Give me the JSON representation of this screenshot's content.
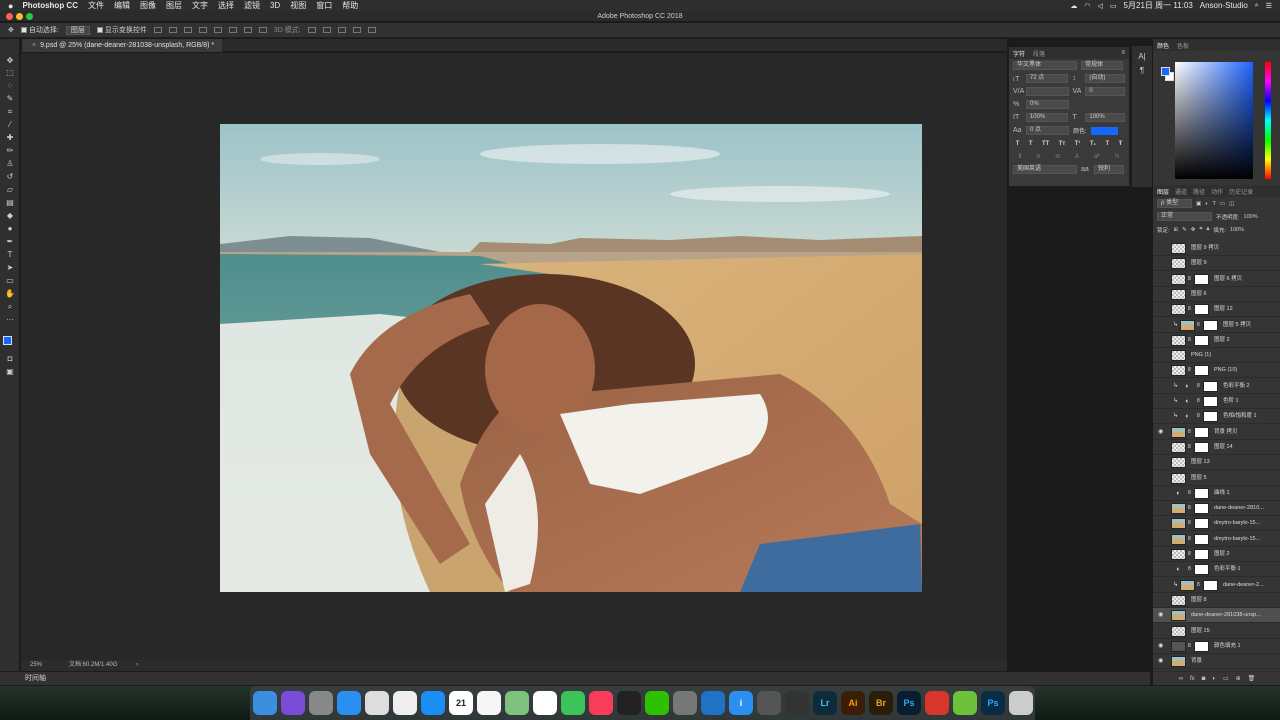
{
  "menubar": {
    "app_name": "Photoshop CC",
    "items": [
      "文件",
      "编辑",
      "图像",
      "图层",
      "文字",
      "选择",
      "滤镜",
      "3D",
      "视图",
      "窗口",
      "帮助"
    ],
    "datetime": "5月21日 周一 11:03",
    "user": "Anson-Studio"
  },
  "window": {
    "title": "Adobe Photoshop CC 2018",
    "tab": "9.psd @ 25% (dane-deaner-281038-unsplash, RGB/8) *"
  },
  "options": {
    "auto_select": "自动选择:",
    "auto_select_value": "图层",
    "show_transform": "显示变换控件",
    "mode_3d": "3D 模式:"
  },
  "status": {
    "zoom": "25%",
    "doc": "文档:60.2M/1.40G",
    "timeline": "时间轴"
  },
  "character": {
    "tabs": [
      "字符",
      "段落"
    ],
    "font_family": "华文黑体",
    "font_style": "常规体",
    "size": "72 点",
    "leading": "(自动)",
    "kerning": "",
    "tracking": "0",
    "scale_pct": "0%",
    "vscale": "100%",
    "hscale": "100%",
    "baseline": "0 点",
    "color_label": "颜色:",
    "language": "美国英语",
    "antialias": "锐利",
    "color": "#1467ff"
  },
  "colorpanel": {
    "tabs": [
      "颜色",
      "色板"
    ],
    "fg": "#1467ff",
    "bg": "#ffffff"
  },
  "layers": {
    "tabs": [
      "图层",
      "通道",
      "路径",
      "动作",
      "历史记录"
    ],
    "filter": "ρ 类型",
    "blend": "正常",
    "opacity_label": "不透明度:",
    "opacity": "100%",
    "lock_label": "锁定:",
    "fill_label": "填充:",
    "fill": "100%",
    "rows": [
      {
        "name": "图层 9 拷贝",
        "vis": false,
        "mask": false,
        "clip": false,
        "thumb": "check",
        "active": false
      },
      {
        "name": "图层 9",
        "vis": false,
        "mask": false,
        "clip": false,
        "thumb": "check",
        "active": false
      },
      {
        "name": "图层 6 拷贝",
        "vis": false,
        "mask": true,
        "clip": false,
        "thumb": "check",
        "active": false
      },
      {
        "name": "图层 6",
        "vis": false,
        "mask": false,
        "clip": false,
        "thumb": "check",
        "active": false
      },
      {
        "name": "图层 12",
        "vis": false,
        "mask": true,
        "clip": false,
        "thumb": "check",
        "active": false
      },
      {
        "name": "图层 5 拷贝",
        "vis": false,
        "mask": true,
        "clip": true,
        "thumb": "photo",
        "active": false
      },
      {
        "name": "图层 2",
        "vis": false,
        "mask": true,
        "clip": false,
        "thumb": "check",
        "active": false
      },
      {
        "name": "PNG (1)",
        "vis": false,
        "mask": false,
        "clip": false,
        "thumb": "check",
        "active": false
      },
      {
        "name": "PNG (10)",
        "vis": false,
        "mask": true,
        "clip": false,
        "thumb": "check",
        "active": false
      },
      {
        "name": "色彩平衡 2",
        "vis": false,
        "mask": true,
        "clip": true,
        "thumb": "adj",
        "active": false
      },
      {
        "name": "色阶 1",
        "vis": false,
        "mask": true,
        "clip": true,
        "thumb": "adj",
        "active": false
      },
      {
        "name": "色相/饱和度 1",
        "vis": false,
        "mask": true,
        "clip": true,
        "thumb": "adj",
        "active": false
      },
      {
        "name": "背景 拷贝",
        "vis": true,
        "mask": true,
        "clip": false,
        "thumb": "photo",
        "active": false
      },
      {
        "name": "图层 14",
        "vis": false,
        "mask": true,
        "clip": false,
        "thumb": "check",
        "active": false
      },
      {
        "name": "图层 13",
        "vis": false,
        "mask": false,
        "clip": false,
        "thumb": "check",
        "active": false
      },
      {
        "name": "图层 5",
        "vis": false,
        "mask": false,
        "clip": false,
        "thumb": "check",
        "active": false
      },
      {
        "name": "曲线 1",
        "vis": false,
        "mask": true,
        "clip": false,
        "thumb": "adj",
        "active": false
      },
      {
        "name": "dane-deaner-2810...",
        "vis": false,
        "mask": true,
        "clip": false,
        "thumb": "photo",
        "active": false
      },
      {
        "name": "dmytro-barylo-15...",
        "vis": false,
        "mask": true,
        "clip": false,
        "thumb": "photo",
        "active": false
      },
      {
        "name": "dmytro-barylo-15...",
        "vis": false,
        "mask": true,
        "clip": false,
        "thumb": "photo",
        "active": false
      },
      {
        "name": "图层 2",
        "vis": false,
        "mask": true,
        "clip": false,
        "thumb": "check",
        "active": false
      },
      {
        "name": "色彩平衡 1",
        "vis": false,
        "mask": true,
        "clip": false,
        "thumb": "adj",
        "active": false
      },
      {
        "name": "dane-deaner-2...",
        "vis": false,
        "mask": true,
        "clip": true,
        "thumb": "photo",
        "active": false
      },
      {
        "name": "图层 8",
        "vis": false,
        "mask": false,
        "clip": false,
        "thumb": "check",
        "active": false
      },
      {
        "name": "dane-deaner-281038-unsp...",
        "vis": true,
        "mask": false,
        "clip": false,
        "thumb": "photo",
        "active": true
      },
      {
        "name": "图层 15",
        "vis": false,
        "mask": false,
        "clip": false,
        "thumb": "check",
        "active": false
      },
      {
        "name": "颜色填充 1",
        "vis": true,
        "mask": true,
        "clip": false,
        "thumb": "dark",
        "active": false
      },
      {
        "name": "背景",
        "vis": true,
        "mask": false,
        "clip": false,
        "thumb": "photo",
        "active": false
      }
    ]
  },
  "dock": [
    {
      "name": "finder",
      "color": "#3b8fe0",
      "label": ""
    },
    {
      "name": "siri",
      "color": "#7a4bd6",
      "label": ""
    },
    {
      "name": "launchpad",
      "color": "#888888",
      "label": ""
    },
    {
      "name": "safari",
      "color": "#2a8ff0",
      "label": ""
    },
    {
      "name": "chrome",
      "color": "#dddddd",
      "label": ""
    },
    {
      "name": "preview",
      "color": "#eeeeee",
      "label": ""
    },
    {
      "name": "app-store",
      "color": "#1b8ef5",
      "label": ""
    },
    {
      "name": "calendar",
      "color": "#ffffff",
      "label": "21"
    },
    {
      "name": "notes",
      "color": "#f6f6f6",
      "label": ""
    },
    {
      "name": "maps",
      "color": "#7ec07e",
      "label": ""
    },
    {
      "name": "photos",
      "color": "#ffffff",
      "label": ""
    },
    {
      "name": "facetime",
      "color": "#3cc45a",
      "label": ""
    },
    {
      "name": "music",
      "color": "#fa3c5a",
      "label": ""
    },
    {
      "name": "qq",
      "color": "#222222",
      "label": ""
    },
    {
      "name": "wechat",
      "color": "#2dc100",
      "label": ""
    },
    {
      "name": "system-prefs",
      "color": "#777777",
      "label": ""
    },
    {
      "name": "edge",
      "color": "#1e73c7",
      "label": ""
    },
    {
      "name": "info",
      "color": "#2a8ff0",
      "label": "i"
    },
    {
      "name": "send",
      "color": "#555555",
      "label": ""
    },
    {
      "name": "final-cut",
      "color": "#333333",
      "label": ""
    },
    {
      "name": "lightroom",
      "color": "#0f2a3a",
      "label": "Lr"
    },
    {
      "name": "illustrator",
      "color": "#3a1e08",
      "label": "Ai"
    },
    {
      "name": "bridge",
      "color": "#2a1d05",
      "label": "Br"
    },
    {
      "name": "photoshop",
      "color": "#071e2f",
      "label": "Ps"
    },
    {
      "name": "netease-music",
      "color": "#d8362c",
      "label": ""
    },
    {
      "name": "utility",
      "color": "#6cc23a",
      "label": ""
    },
    {
      "name": "psd-file",
      "color": "#0a2b45",
      "label": "Ps"
    },
    {
      "name": "trash",
      "color": "#cccccc",
      "label": ""
    }
  ]
}
